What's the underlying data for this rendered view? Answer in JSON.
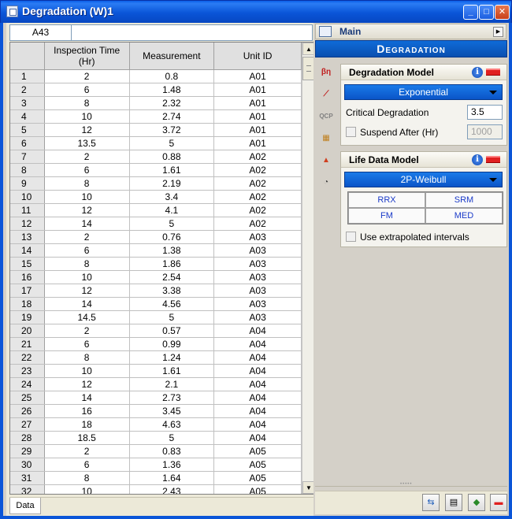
{
  "window": {
    "title": "Degradation (W)1"
  },
  "cellbar": {
    "ref": "A43",
    "formula": ""
  },
  "grid": {
    "headers": [
      "",
      "Inspection Time (Hr)",
      "Measurement",
      "Unit ID"
    ],
    "rows": [
      [
        "1",
        "2",
        "0.8",
        "A01"
      ],
      [
        "2",
        "6",
        "1.48",
        "A01"
      ],
      [
        "3",
        "8",
        "2.32",
        "A01"
      ],
      [
        "4",
        "10",
        "2.74",
        "A01"
      ],
      [
        "5",
        "12",
        "3.72",
        "A01"
      ],
      [
        "6",
        "13.5",
        "5",
        "A01"
      ],
      [
        "7",
        "2",
        "0.88",
        "A02"
      ],
      [
        "8",
        "6",
        "1.61",
        "A02"
      ],
      [
        "9",
        "8",
        "2.19",
        "A02"
      ],
      [
        "10",
        "10",
        "3.4",
        "A02"
      ],
      [
        "11",
        "12",
        "4.1",
        "A02"
      ],
      [
        "12",
        "14",
        "5",
        "A02"
      ],
      [
        "13",
        "2",
        "0.76",
        "A03"
      ],
      [
        "14",
        "6",
        "1.38",
        "A03"
      ],
      [
        "15",
        "8",
        "1.86",
        "A03"
      ],
      [
        "16",
        "10",
        "2.54",
        "A03"
      ],
      [
        "17",
        "12",
        "3.38",
        "A03"
      ],
      [
        "18",
        "14",
        "4.56",
        "A03"
      ],
      [
        "19",
        "14.5",
        "5",
        "A03"
      ],
      [
        "20",
        "2",
        "0.57",
        "A04"
      ],
      [
        "21",
        "6",
        "0.99",
        "A04"
      ],
      [
        "22",
        "8",
        "1.24",
        "A04"
      ],
      [
        "23",
        "10",
        "1.61",
        "A04"
      ],
      [
        "24",
        "12",
        "2.1",
        "A04"
      ],
      [
        "25",
        "14",
        "2.73",
        "A04"
      ],
      [
        "26",
        "16",
        "3.45",
        "A04"
      ],
      [
        "27",
        "18",
        "4.63",
        "A04"
      ],
      [
        "28",
        "18.5",
        "5",
        "A04"
      ],
      [
        "29",
        "2",
        "0.83",
        "A05"
      ],
      [
        "30",
        "6",
        "1.36",
        "A05"
      ],
      [
        "31",
        "8",
        "1.64",
        "A05"
      ],
      [
        "32",
        "10",
        "2.43",
        "A05"
      ]
    ]
  },
  "sheet_tab": "Data",
  "right": {
    "main_label": "Main",
    "banner": "Degradation",
    "degradation_model": {
      "title": "Degradation Model",
      "model": "Exponential",
      "critical_label": "Critical Degradation",
      "critical_value": "3.5",
      "suspend_label": "Suspend After (Hr)",
      "suspend_value": "1000"
    },
    "life_data_model": {
      "title": "Life Data Model",
      "model": "2P-Weibull",
      "buttons": [
        "RRX",
        "SRM",
        "FM",
        "MED"
      ],
      "extrapolated_label": "Use extrapolated intervals"
    }
  },
  "colors": {
    "titlebar": "#0a55d8",
    "accent_blue": "#0a55c8",
    "red": "#e02020"
  }
}
